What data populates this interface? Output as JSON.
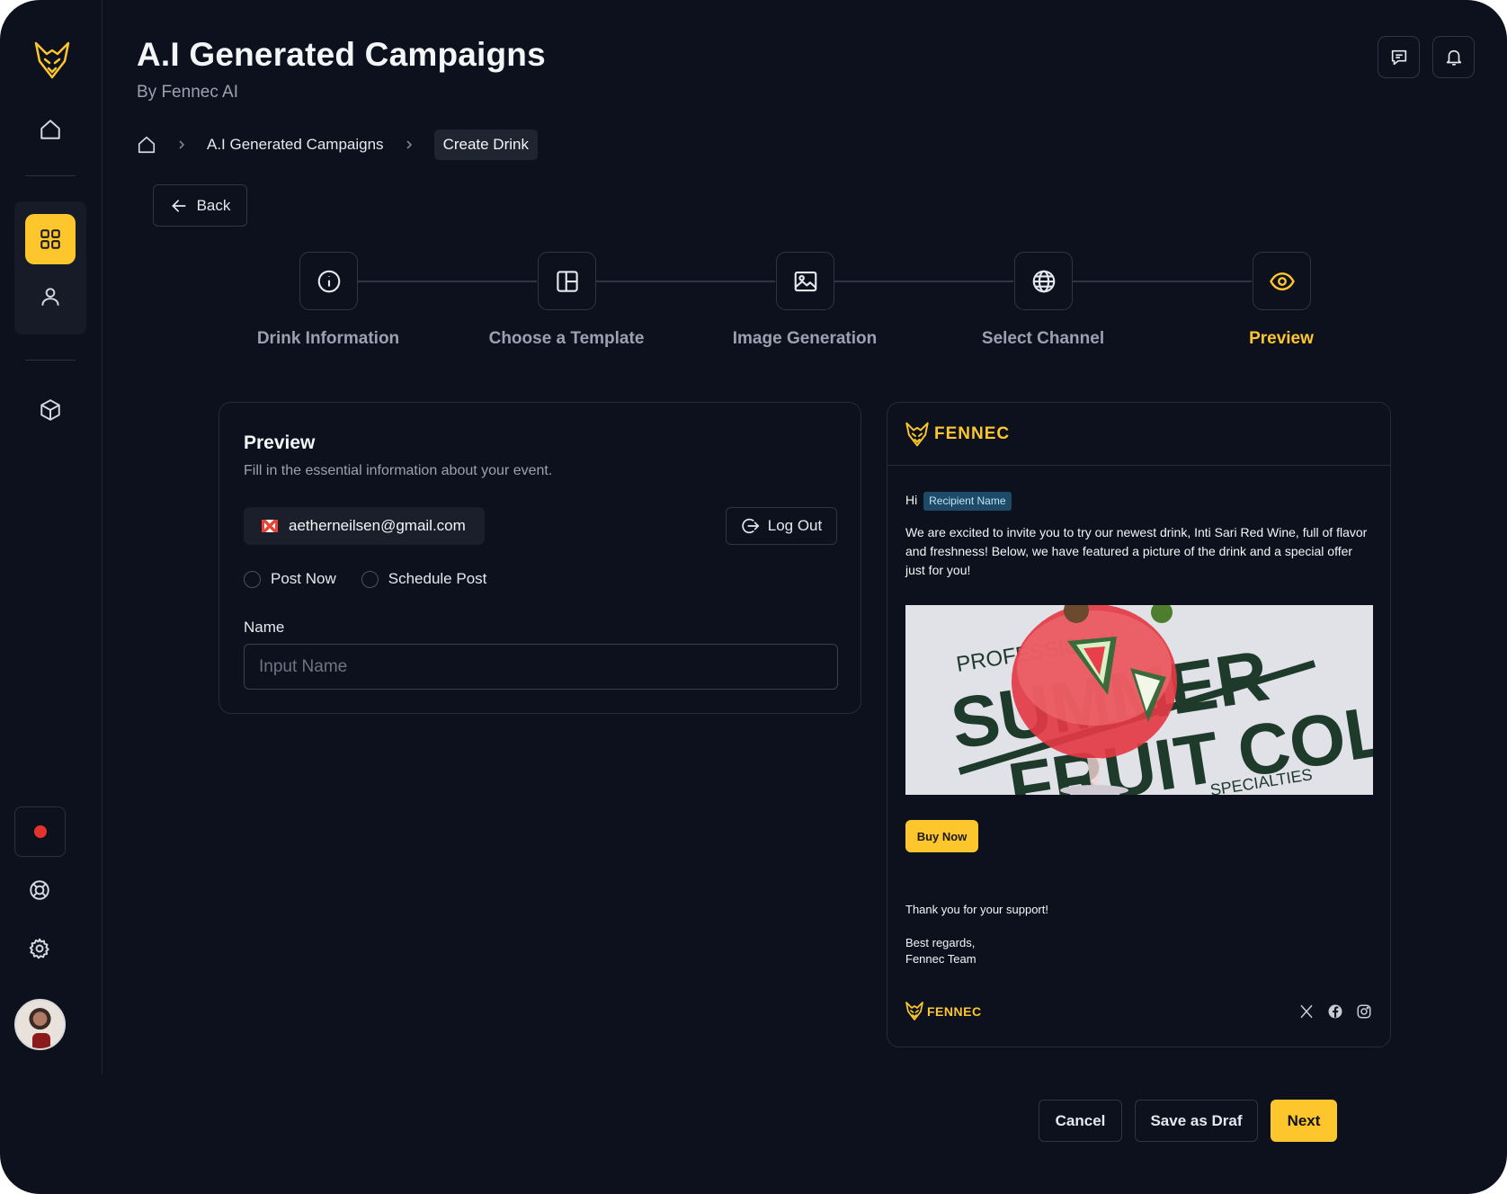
{
  "header": {
    "title": "A.I Generated Campaigns",
    "subtitle": "By Fennec AI"
  },
  "breadcrumb": {
    "items": [
      "A.I Generated Campaigns",
      "Create Drink"
    ]
  },
  "back_label": "Back",
  "stepper": {
    "steps": [
      {
        "label": "Drink Information",
        "icon": "info-icon"
      },
      {
        "label": "Choose a Template",
        "icon": "layout-icon"
      },
      {
        "label": "Image Generation",
        "icon": "image-icon"
      },
      {
        "label": "Select Channel",
        "icon": "globe-icon"
      },
      {
        "label": "Preview",
        "icon": "eye-icon",
        "active": true
      }
    ]
  },
  "form": {
    "title": "Preview",
    "subtitle": "Fill in the essential information about your event.",
    "email": "aetherneilsen@gmail.com",
    "logout_label": "Log Out",
    "radio_post_now": "Post Now",
    "radio_schedule": "Schedule Post",
    "name_label": "Name",
    "name_placeholder": "Input Name"
  },
  "email_preview": {
    "brand": "FENNEC",
    "greeting": "Hi",
    "recipient_tag": "Recipient Name",
    "intro": "We are excited to invite you to try our newest drink, Inti Sari Red Wine, full of flavor and freshness! Below, we have featured a picture of the drink and a special offer just for you!",
    "hero_text": {
      "line1": "PROFESSIONAL",
      "line2": "SUMMER",
      "line3": "FRUIT COLD",
      "line4": "SPECIALTIES"
    },
    "buy_label": "Buy Now",
    "thanks": "Thank you for your support!",
    "regards_line1": "Best regards,",
    "regards_line2": "Fennec Team",
    "footer_brand": "FENNEC"
  },
  "footer": {
    "cancel": "Cancel",
    "save_draft": "Save as Draf",
    "next": "Next"
  },
  "colors": {
    "background": "#0c111d",
    "accent": "#fcc62c",
    "record": "#e5322d"
  }
}
